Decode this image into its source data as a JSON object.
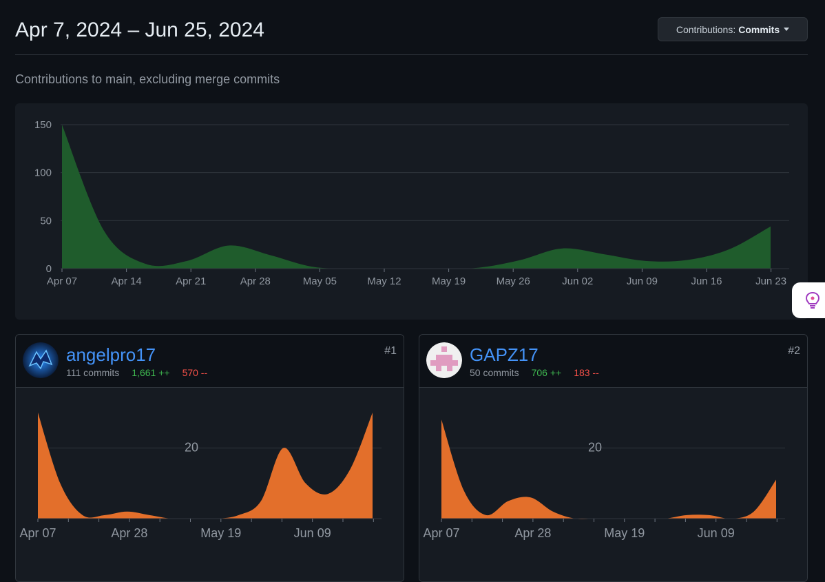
{
  "header": {
    "date_range": "Apr 7, 2024 – Jun 25, 2024",
    "contributions_label": "Contributions:",
    "contributions_value": "Commits"
  },
  "subtitle": "Contributions to main, excluding merge commits",
  "colors": {
    "main_area": "#1f5c2c",
    "user_area": "#e36f2b",
    "link": "#4493f8",
    "additions": "#3fb950",
    "deletions": "#f85149"
  },
  "icons": {
    "contrib_dropdown": "caret-down-icon",
    "assistant": "lightbulb-icon"
  },
  "chart_data": [
    {
      "type": "area",
      "title": "",
      "ylim": [
        0,
        150
      ],
      "yticks": [
        0,
        50,
        100,
        150
      ],
      "ytick_labels": [
        "0",
        "50",
        "100",
        "150"
      ],
      "grid": true,
      "x": [
        "Apr 07",
        "Apr 14",
        "Apr 21",
        "Apr 28",
        "May 05",
        "May 12",
        "May 19",
        "May 26",
        "Jun 02",
        "Jun 09",
        "Jun 16",
        "Jun 23"
      ],
      "series": [
        {
          "values": [
            152,
            40,
            5,
            8,
            24,
            14,
            2,
            0,
            0,
            0,
            1,
            9,
            21,
            15,
            8,
            9,
            20,
            44
          ]
        }
      ]
    },
    {
      "type": "area",
      "ylim": [
        0,
        30
      ],
      "yticks": [
        20
      ],
      "ytick_labels": [
        "20"
      ],
      "x": [
        "Apr 07",
        "Apr 28",
        "May 19",
        "Jun 09"
      ],
      "series": [
        {
          "values": [
            33,
            10,
            1,
            1,
            2,
            1,
            0,
            0,
            0,
            1,
            5,
            20,
            10,
            7,
            14,
            34
          ]
        }
      ]
    },
    {
      "type": "area",
      "ylim": [
        0,
        30
      ],
      "yticks": [
        20
      ],
      "ytick_labels": [
        "20"
      ],
      "x": [
        "Apr 07",
        "Apr 28",
        "May 19",
        "Jun 09"
      ],
      "series": [
        {
          "values": [
            28,
            8,
            1,
            5,
            6,
            2,
            0,
            0,
            0,
            0,
            0,
            1,
            1,
            0,
            2,
            11
          ]
        }
      ]
    }
  ],
  "contributors": [
    {
      "rank": "#1",
      "name": "angelpro17",
      "commits": "111 commits",
      "additions": "1,661 ++",
      "deletions": "570 --",
      "avatar": "dragon-avatar-icon"
    },
    {
      "rank": "#2",
      "name": "GAPZ17",
      "commits": "50 commits",
      "additions": "706 ++",
      "deletions": "183 --",
      "avatar": "pixel-avatar-icon"
    }
  ]
}
